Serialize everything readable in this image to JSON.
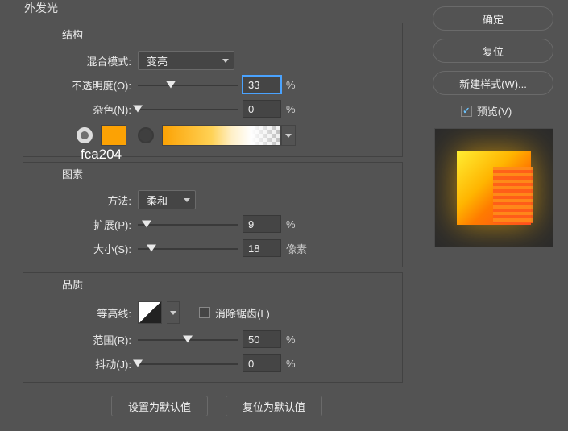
{
  "top_title": "外发光",
  "structure": {
    "title": "结构",
    "blend_mode_label": "混合模式:",
    "blend_mode_value": "变亮",
    "opacity_label": "不透明度(O):",
    "opacity_value": "33",
    "opacity_pct": 33,
    "noise_label": "杂色(N):",
    "noise_value": "0",
    "noise_pct": 0,
    "hex_text": "fca204",
    "percent": "%"
  },
  "pattern": {
    "title": "图素",
    "method_label": "方法:",
    "method_value": "柔和",
    "spread_label": "扩展(P):",
    "spread_value": "9",
    "spread_pct": 9,
    "size_label": "大小(S):",
    "size_value": "18",
    "size_pct": 14,
    "size_unit": "像素",
    "percent": "%"
  },
  "quality": {
    "title": "品质",
    "contour_label": "等高线:",
    "antialias_label": "消除锯齿(L)",
    "range_label": "范围(R):",
    "range_value": "50",
    "range_pct": 50,
    "jitter_label": "抖动(J):",
    "jitter_value": "0",
    "jitter_pct": 0,
    "percent": "%"
  },
  "bottom": {
    "set_default": "设置为默认值",
    "reset_default": "复位为默认值"
  },
  "side": {
    "ok": "确定",
    "reset": "复位",
    "new_style": "新建样式(W)...",
    "preview": "预览(V)"
  }
}
